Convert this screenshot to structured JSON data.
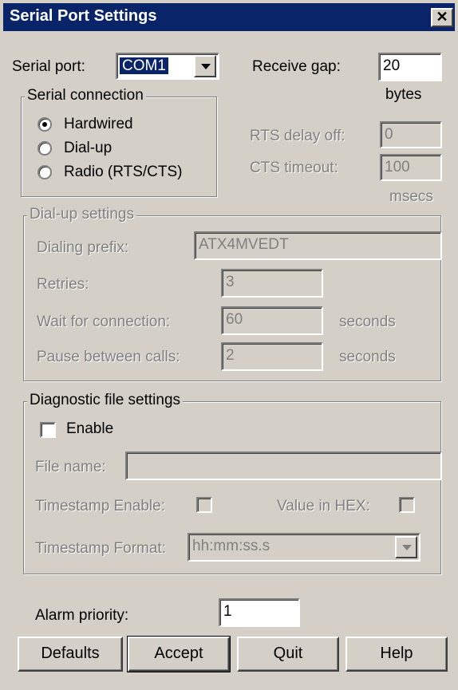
{
  "window": {
    "title": "Serial Port Settings",
    "close_glyph": "✕"
  },
  "serial_port": {
    "label": "Serial port:",
    "value": "COM1"
  },
  "receive_gap": {
    "label": "Receive gap:",
    "value": "20",
    "unit": "bytes"
  },
  "serial_connection": {
    "title": "Serial connection",
    "options": [
      "Hardwired",
      "Dial-up",
      "Radio (RTS/CTS)"
    ],
    "selected": "Hardwired"
  },
  "rts_delay_off": {
    "label": "RTS delay off:",
    "value": "0"
  },
  "cts_timeout": {
    "label": "CTS timeout:",
    "value": "100",
    "unit": "msecs"
  },
  "dialup": {
    "title": "Dial-up settings",
    "dialing_prefix": {
      "label": "Dialing prefix:",
      "value": "ATX4MVEDT"
    },
    "retries": {
      "label": "Retries:",
      "value": "3"
    },
    "wait_for_connection": {
      "label": "Wait for connection:",
      "value": "60",
      "unit": "seconds"
    },
    "pause_between_calls": {
      "label": "Pause between calls:",
      "value": "2",
      "unit": "seconds"
    }
  },
  "diagnostic": {
    "title": "Diagnostic file settings",
    "enable_label": "Enable",
    "enable_checked": false,
    "file_name_label": "File name:",
    "file_name_value": "",
    "timestamp_enable_label": "Timestamp Enable:",
    "value_in_hex_label": "Value in HEX:",
    "timestamp_format_label": "Timestamp Format:",
    "timestamp_format_value": "hh:mm:ss.s"
  },
  "alarm_priority": {
    "label": "Alarm priority:",
    "value": "1"
  },
  "buttons": {
    "defaults": "Defaults",
    "accept": "Accept",
    "quit": "Quit",
    "help": "Help"
  },
  "colors": {
    "titlebar": "#0a246a",
    "face": "#d4d0c8",
    "disabled_text": "#808080"
  }
}
